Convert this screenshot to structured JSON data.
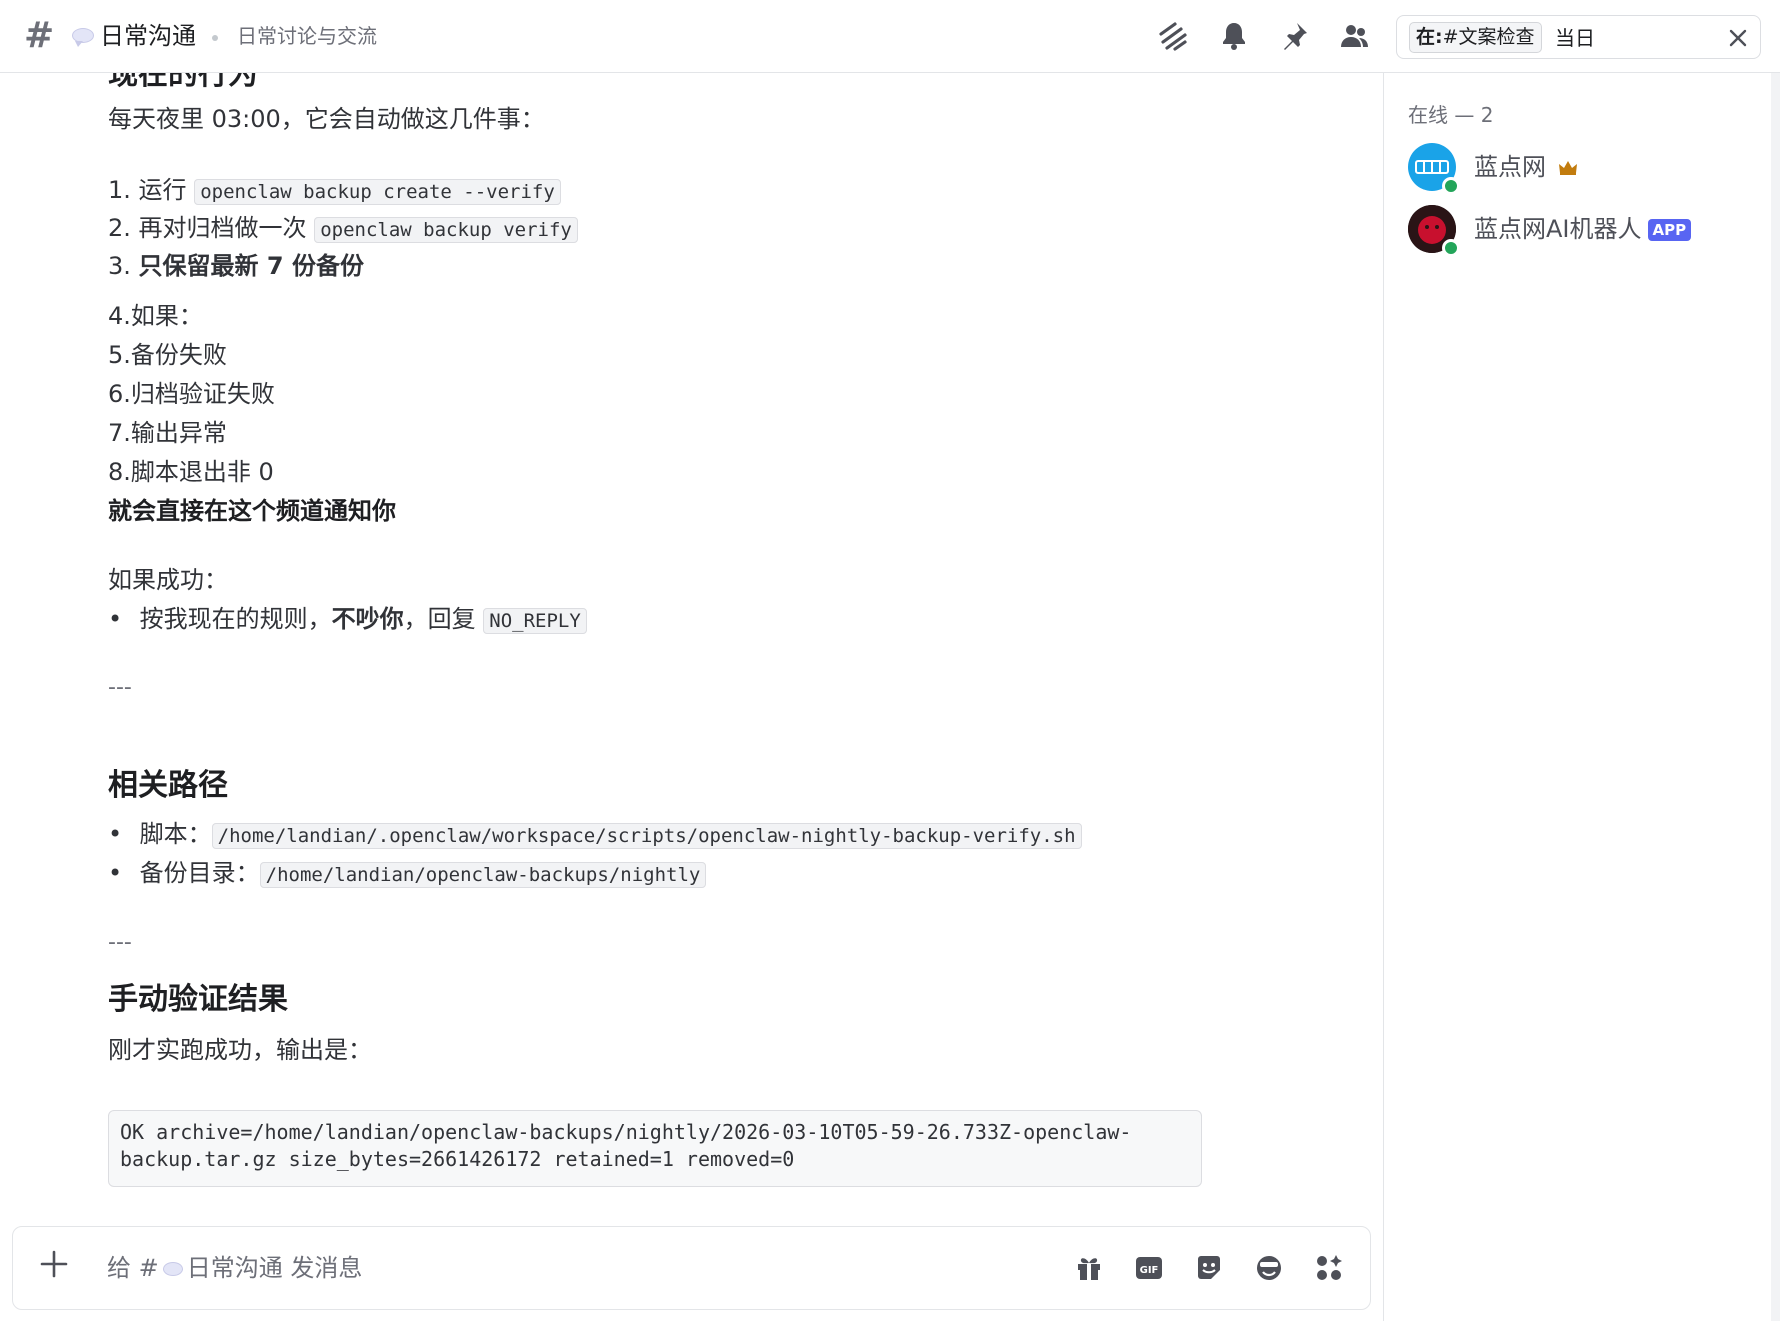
{
  "header": {
    "channel_name": "日常沟通",
    "topic": "日常讨论与交流",
    "search": {
      "scope_label": "在:",
      "scope_channel": "#文案检查",
      "term": "当日"
    },
    "icons": [
      "threads-icon",
      "bell-icon",
      "pin-icon",
      "members-icon"
    ]
  },
  "messages": {
    "partial_heading": "现在的行为",
    "intro": "每天夜里 03:00，它会自动做这几件事：",
    "steps": [
      {
        "num": "1.",
        "text": "运行 ",
        "code": "openclaw backup create --verify"
      },
      {
        "num": "2.",
        "text": "再对归档做一次 ",
        "code": "openclaw backup verify"
      },
      {
        "num": "3.",
        "text": "只保留最新 7 份备份"
      }
    ],
    "conditions": [
      {
        "num": "4.",
        "text": "如果："
      },
      {
        "num": "5.",
        "text": "备份失败"
      },
      {
        "num": "6.",
        "text": "归档验证失败"
      },
      {
        "num": "7.",
        "text": "输出异常"
      },
      {
        "num": "8.",
        "text": "脚本退出非 0"
      }
    ],
    "notify": "就会直接在这个频道通知你",
    "success_label": "如果成功：",
    "success_bullet": {
      "pre": "按我现在的规则，",
      "bold": "不吵你",
      "mid": "，回复 ",
      "code": "NO_REPLY"
    },
    "separator": "---",
    "paths_heading": "相关路径",
    "paths": [
      {
        "label": "脚本：",
        "code": "/home/landian/.openclaw/workspace/scripts/openclaw-nightly-backup-verify.sh"
      },
      {
        "label": "备份目录：",
        "code": "/home/landian/openclaw-backups/nightly"
      }
    ],
    "verify_heading": "手动验证结果",
    "verify_intro": "刚才实跑成功，输出是：",
    "output_lines": [
      "OK archive=/home/landian/openclaw-backups/nightly/2026-03-10T05-59-26.733Z-openclaw-",
      "backup.tar.gz size_bytes=2661426172 retained=1 removed=0"
    ]
  },
  "composer": {
    "placeholder_pre": "给 #",
    "placeholder_channel": "日常沟通",
    "placeholder_post": " 发消息",
    "icons": [
      "plus-icon",
      "gift-icon",
      "gif-icon",
      "sticker-icon",
      "emoji-icon",
      "apps-icon"
    ],
    "gif_label": "GIF"
  },
  "sidebar": {
    "online_header": "在线 — 2",
    "members": [
      {
        "name": "蓝点网",
        "crown": true,
        "avatar_color": "#1aa3e8"
      },
      {
        "name": "蓝点网AI机器人",
        "badge": "APP",
        "avatar_color": "#c8102e"
      }
    ]
  },
  "colors": {
    "accent": "#5865f2",
    "online": "#23a55a",
    "crown": "#c27c0e"
  }
}
